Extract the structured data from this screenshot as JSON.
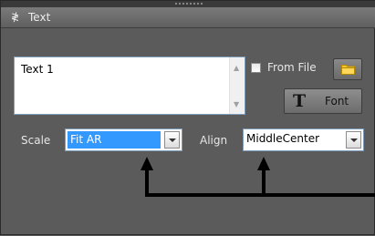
{
  "panel": {
    "title": "Text",
    "collapse_icon": "chevron-double-down-icon"
  },
  "text_input": {
    "value": "Text 1"
  },
  "from_file": {
    "label": "From File",
    "checked": false
  },
  "font_button": {
    "label": "Font",
    "icon_glyph": "T"
  },
  "scale": {
    "label": "Scale",
    "value": "Fit AR"
  },
  "align": {
    "label": "Align",
    "value": "MiddleCenter"
  },
  "colors": {
    "background": "#5b5b5b",
    "selection": "#3399ff",
    "annotation": "#000000"
  }
}
